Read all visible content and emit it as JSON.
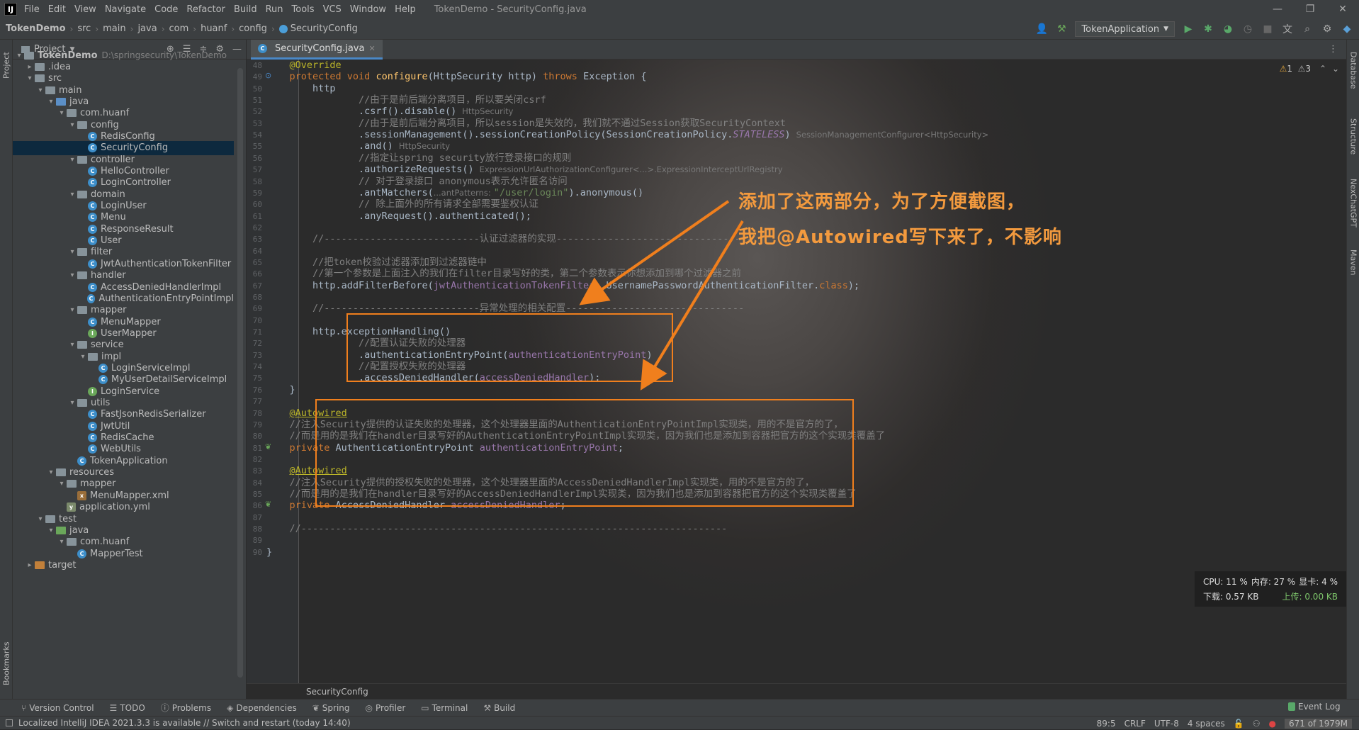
{
  "menu": [
    "File",
    "Edit",
    "View",
    "Navigate",
    "Code",
    "Refactor",
    "Build",
    "Run",
    "Tools",
    "VCS",
    "Window",
    "Help"
  ],
  "window_title": "TokenDemo - SecurityConfig.java",
  "breadcrumb": [
    "TokenDemo",
    "src",
    "main",
    "java",
    "com",
    "huanf",
    "config",
    "SecurityConfig"
  ],
  "run_config": "TokenApplication",
  "project_panel": {
    "title": "Project"
  },
  "tree": [
    {
      "label": "TokenDemo",
      "extra": "D:\\springsecurity\\TokenDemo",
      "indent": 0,
      "arrow": "▾",
      "icon": "folder",
      "bold": true
    },
    {
      "label": ".idea",
      "indent": 1,
      "arrow": "▸",
      "icon": "folder"
    },
    {
      "label": "src",
      "indent": 1,
      "arrow": "▾",
      "icon": "folder"
    },
    {
      "label": "main",
      "indent": 2,
      "arrow": "▾",
      "icon": "folder"
    },
    {
      "label": "java",
      "indent": 3,
      "arrow": "▾",
      "icon": "folder-blue"
    },
    {
      "label": "com.huanf",
      "indent": 4,
      "arrow": "▾",
      "icon": "folder"
    },
    {
      "label": "config",
      "indent": 5,
      "arrow": "▾",
      "icon": "folder"
    },
    {
      "label": "RedisConfig",
      "indent": 6,
      "icon": "class"
    },
    {
      "label": "SecurityConfig",
      "indent": 6,
      "icon": "class",
      "selected": true
    },
    {
      "label": "controller",
      "indent": 5,
      "arrow": "▾",
      "icon": "folder"
    },
    {
      "label": "HelloController",
      "indent": 6,
      "icon": "class"
    },
    {
      "label": "LoginController",
      "indent": 6,
      "icon": "class"
    },
    {
      "label": "domain",
      "indent": 5,
      "arrow": "▾",
      "icon": "folder"
    },
    {
      "label": "LoginUser",
      "indent": 6,
      "icon": "class"
    },
    {
      "label": "Menu",
      "indent": 6,
      "icon": "class"
    },
    {
      "label": "ResponseResult",
      "indent": 6,
      "icon": "class"
    },
    {
      "label": "User",
      "indent": 6,
      "icon": "class"
    },
    {
      "label": "filter",
      "indent": 5,
      "arrow": "▾",
      "icon": "folder"
    },
    {
      "label": "JwtAuthenticationTokenFilter",
      "indent": 6,
      "icon": "class"
    },
    {
      "label": "handler",
      "indent": 5,
      "arrow": "▾",
      "icon": "folder"
    },
    {
      "label": "AccessDeniedHandlerImpl",
      "indent": 6,
      "icon": "class"
    },
    {
      "label": "AuthenticationEntryPointImpl",
      "indent": 6,
      "icon": "class"
    },
    {
      "label": "mapper",
      "indent": 5,
      "arrow": "▾",
      "icon": "folder"
    },
    {
      "label": "MenuMapper",
      "indent": 6,
      "icon": "class"
    },
    {
      "label": "UserMapper",
      "indent": 6,
      "icon": "interface"
    },
    {
      "label": "service",
      "indent": 5,
      "arrow": "▾",
      "icon": "folder"
    },
    {
      "label": "impl",
      "indent": 6,
      "arrow": "▾",
      "icon": "folder"
    },
    {
      "label": "LoginServiceImpl",
      "indent": 7,
      "icon": "class"
    },
    {
      "label": "MyUserDetailServiceImpl",
      "indent": 7,
      "icon": "class"
    },
    {
      "label": "LoginService",
      "indent": 6,
      "icon": "interface"
    },
    {
      "label": "utils",
      "indent": 5,
      "arrow": "▾",
      "icon": "folder"
    },
    {
      "label": "FastJsonRedisSerializer",
      "indent": 6,
      "icon": "class"
    },
    {
      "label": "JwtUtil",
      "indent": 6,
      "icon": "class"
    },
    {
      "label": "RedisCache",
      "indent": 6,
      "icon": "class"
    },
    {
      "label": "WebUtils",
      "indent": 6,
      "icon": "class"
    },
    {
      "label": "TokenApplication",
      "indent": 5,
      "icon": "class"
    },
    {
      "label": "resources",
      "indent": 3,
      "arrow": "▾",
      "icon": "folder"
    },
    {
      "label": "mapper",
      "indent": 4,
      "arrow": "▾",
      "icon": "folder"
    },
    {
      "label": "MenuMapper.xml",
      "indent": 5,
      "icon": "xml"
    },
    {
      "label": "application.yml",
      "indent": 4,
      "icon": "yml"
    },
    {
      "label": "test",
      "indent": 2,
      "arrow": "▾",
      "icon": "folder"
    },
    {
      "label": "java",
      "indent": 3,
      "arrow": "▾",
      "icon": "folder-green"
    },
    {
      "label": "com.huanf",
      "indent": 4,
      "arrow": "▾",
      "icon": "folder"
    },
    {
      "label": "MapperTest",
      "indent": 5,
      "icon": "class"
    },
    {
      "label": "target",
      "indent": 1,
      "arrow": "▸",
      "icon": "folder-orange"
    }
  ],
  "editor_tab": "SecurityConfig.java",
  "code_lines": [
    {
      "n": 48,
      "html": "    <span class='ann'>@Override</span>"
    },
    {
      "n": 49,
      "html": "    <span class='kw'>protected void </span><span style='color:#ffc66d'>configure</span>(HttpSecurity http) <span class='kw'>throws </span>Exception {"
    },
    {
      "n": 50,
      "html": "        http"
    },
    {
      "n": 51,
      "html": "                <span class='cm'>//由于是前后端分离项目，所以要关闭csrf</span>"
    },
    {
      "n": 52,
      "html": "                .csrf().disable()<span class='hint'>HttpSecurity</span>"
    },
    {
      "n": 53,
      "html": "                <span class='cm'>//由于是前后端分离项目，所以session是失效的，我们就不通过Session获取SecurityContext</span>"
    },
    {
      "n": 54,
      "html": "                .sessionManagement().sessionCreationPolicy(SessionCreationPolicy.<span class='fld it'>STATELESS</span>)<span class='hint'>SessionManagementConfigurer&lt;HttpSecurity&gt;</span>"
    },
    {
      "n": 55,
      "html": "                .and()<span class='hint'>HttpSecurity</span>"
    },
    {
      "n": 56,
      "html": "                <span class='cm'>//指定让spring security放行登录接口的规则</span>"
    },
    {
      "n": 57,
      "html": "                .authorizeRequests()<span class='hint'>ExpressionUrlAuthorizationConfigurer&lt;...&gt;.ExpressionInterceptUrlRegistry</span>"
    },
    {
      "n": 58,
      "html": "                <span class='cm'>// 对于登录接口 anonymous表示允许匿名访问</span>"
    },
    {
      "n": 59,
      "html": "                .antMatchers(<span class='hint' style='margin:0 4px 0 0'>...antPatterns:</span><span class='str'>\"/user/login\"</span>).anonymous()"
    },
    {
      "n": 60,
      "html": "                <span class='cm'>// 除上面外的所有请求全部需要鉴权认证</span>"
    },
    {
      "n": 61,
      "html": "                .anyRequest().authenticated();"
    },
    {
      "n": 62,
      "html": ""
    },
    {
      "n": 63,
      "html": "        <span class='cm'>//---------------------------认证过滤器的实现----------------------------------</span>"
    },
    {
      "n": 64,
      "html": ""
    },
    {
      "n": 65,
      "html": "        <span class='cm'>//把token校验过滤器添加到过滤器链中</span>"
    },
    {
      "n": 66,
      "html": "        <span class='cm'>//第一个参数是上面注入的我们在filter目录写好的类，第二个参数表示你想添加到哪个过滤器之前</span>"
    },
    {
      "n": 67,
      "html": "        http.addFilterBefore(<span class='fld'>jwtAuthenticationTokenFilter</span>, UsernamePasswordAuthenticationFilter.<span class='kw'>class</span>);"
    },
    {
      "n": 68,
      "html": ""
    },
    {
      "n": 69,
      "html": "        <span class='cm'>//---------------------------异常处理的相关配置-------------------------------</span>"
    },
    {
      "n": 70,
      "html": ""
    },
    {
      "n": 71,
      "html": "        http.exceptionHandling()"
    },
    {
      "n": 72,
      "html": "                <span class='cm'>//配置认证失败的处理器</span>"
    },
    {
      "n": 73,
      "html": "                .authenticationEntryPoint(<span class='fld'>authenticationEntryPoint</span>)"
    },
    {
      "n": 74,
      "html": "                <span class='cm'>//配置授权失败的处理器</span>"
    },
    {
      "n": 75,
      "html": "                .accessDeniedHandler(<span class='fld'>accessDeniedHandler</span>);"
    },
    {
      "n": 76,
      "html": "    }"
    },
    {
      "n": 77,
      "html": ""
    },
    {
      "n": 78,
      "html": "    <span class='ann' style='text-decoration:underline'>@Autowired</span>"
    },
    {
      "n": 79,
      "html": "    <span class='cm'>//注入Security提供的认证失败的处理器，这个处理器里面的AuthenticationEntryPointImpl实现类，用的不是官方的了，</span>"
    },
    {
      "n": 80,
      "html": "    <span class='cm'>//而是用的是我们在handler目录写好的AuthenticationEntryPointImpl实现类，因为我们也是添加到容器把官方的这个实现类覆盖了</span>"
    },
    {
      "n": 81,
      "html": "    <span class='kw'>private </span>AuthenticationEntryPoint <span class='fld'>authenticationEntryPoint</span>;"
    },
    {
      "n": 82,
      "html": ""
    },
    {
      "n": 83,
      "html": "    <span class='ann' style='text-decoration:underline'>@Autowired</span>"
    },
    {
      "n": 84,
      "html": "    <span class='cm'>//注入Security提供的授权失败的处理器，这个处理器里面的AccessDeniedHandlerImpl实现类，用的不是官方的了，</span>"
    },
    {
      "n": 85,
      "html": "    <span class='cm'>//而是用的是我们在handler目录写好的AccessDeniedHandlerImpl实现类，因为我们也是添加到容器把官方的这个实现类覆盖了</span>"
    },
    {
      "n": 86,
      "html": "    <span class='kw'>private </span>AccessDeniedHandler <span class='fld'>accessDeniedHandler</span>;"
    },
    {
      "n": 87,
      "html": ""
    },
    {
      "n": 88,
      "html": "    <span class='cm'>//--------------------------------------------------------------------------</span>"
    },
    {
      "n": 89,
      "html": ""
    },
    {
      "n": 90,
      "html": "}"
    }
  ],
  "annotation": {
    "line1": "添加了这两部分，为了方便截图，",
    "line2": "我把@Autowired写下来了，不影响"
  },
  "inspections": {
    "warnings": "1",
    "weak": "3"
  },
  "bottom_breadcrumb": "SecurityConfig",
  "sys_monitor": {
    "cpu": "CPU: 11 %",
    "mem": "内存: 27 %",
    "gpu": "显卡: 4 %",
    "down": "下载: 0.57 KB",
    "up": "上传: 0.00 KB"
  },
  "bottom_tools": [
    "Version Control",
    "TODO",
    "Problems",
    "Dependencies",
    "Spring",
    "Profiler",
    "Terminal",
    "Build"
  ],
  "event_log": "Event Log",
  "status": {
    "message": "Localized IntelliJ IDEA 2021.3.3 is available // Switch and restart (today 14:40)",
    "position": "89:5",
    "line_sep": "CRLF",
    "encoding": "UTF-8",
    "indent": "4 spaces",
    "memory": "671 of 1979M"
  },
  "side_tabs": {
    "left": [
      "Project",
      "Bookmarks"
    ],
    "right": [
      "Database",
      "Structure",
      "NexChatGPT",
      "Maven"
    ]
  },
  "colors": {
    "accent": "#4a88c7",
    "highlight": "#f07f1d",
    "annotation": "#f39a3e"
  }
}
